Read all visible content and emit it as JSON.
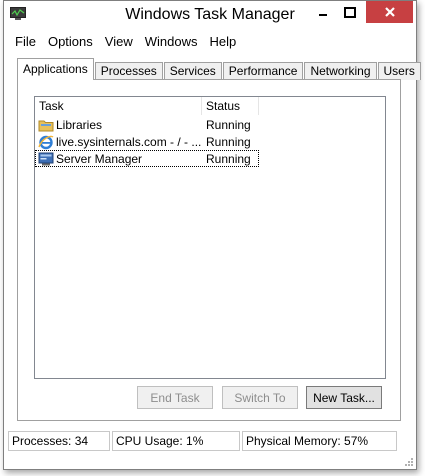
{
  "window": {
    "title": "Windows Task Manager",
    "app_icon": "task-manager-icon",
    "controls": [
      "minimize-icon",
      "maximize-icon",
      "close-icon"
    ],
    "close_color": "#c74042"
  },
  "menu": [
    "File",
    "Options",
    "View",
    "Windows",
    "Help"
  ],
  "tabs": [
    {
      "label": "Applications",
      "active": true
    },
    {
      "label": "Processes",
      "active": false
    },
    {
      "label": "Services",
      "active": false
    },
    {
      "label": "Performance",
      "active": false
    },
    {
      "label": "Networking",
      "active": false
    },
    {
      "label": "Users",
      "active": false
    }
  ],
  "list": {
    "columns": [
      "Task",
      "Status"
    ],
    "rows": [
      {
        "task": "Libraries",
        "status": "Running",
        "icon": "folder-icon"
      },
      {
        "task": "live.sysinternals.com - / - ...",
        "status": "Running",
        "icon": "internet-explorer-icon"
      },
      {
        "task": "Server Manager",
        "status": "Running",
        "icon": "server-manager-icon",
        "focused": true
      }
    ]
  },
  "buttons": {
    "end_task": "End Task",
    "switch_to": "Switch To",
    "new_task": "New Task..."
  },
  "status": {
    "processes": "Processes: 34",
    "cpu": "CPU Usage: 1%",
    "memory": "Physical Memory: 57%"
  }
}
